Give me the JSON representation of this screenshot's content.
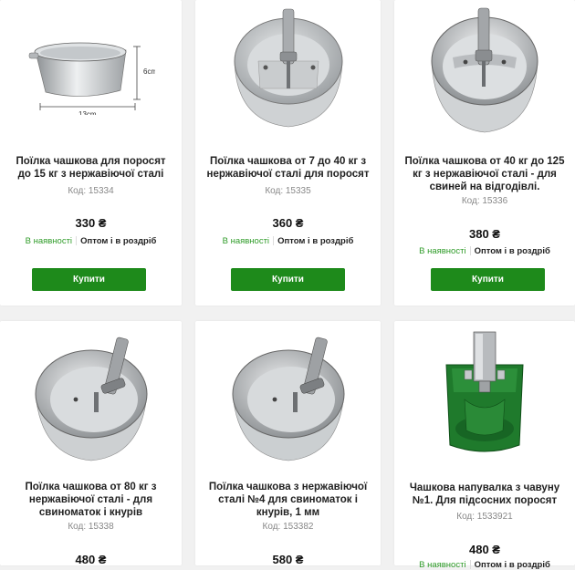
{
  "products": [
    {
      "title": "Поїлка чашкова для поросят до 15 кг з нержавіючої сталі",
      "code": "Код: 15334",
      "price": "330 ₴",
      "stock": "В наявності",
      "sale": "Оптом і в роздріб",
      "button": "Купити",
      "dimensions": {
        "height": "6cm",
        "width": "13cm"
      }
    },
    {
      "title": "Поїлка чашкова от 7 до 40 кг з нержавіючої сталі для поросят",
      "code": "Код: 15335",
      "price": "360 ₴",
      "stock": "В наявності",
      "sale": "Оптом і в роздріб",
      "button": "Купити"
    },
    {
      "title": "Поїлка чашкова от 40 кг до 125 кг з нержавіючої сталі - для свиней на відгодівлі.",
      "code": "Код: 15336",
      "price": "380 ₴",
      "stock": "В наявності",
      "sale": "Оптом і в роздріб",
      "button": "Купити"
    },
    {
      "title": "Поїлка чашкова от 80 кг з нержавіючої сталі - для свиноматок і кнурів",
      "code": "Код: 15338",
      "price": "480 ₴"
    },
    {
      "title": "Поїлка чашкова з нержавіючої сталі №4 для свиноматок і кнурів, 1 мм",
      "code": "Код: 153382",
      "price": "580 ₴"
    },
    {
      "title": "Чашкова напувалка з чавуну №1. Для підсосних поросят",
      "code": "Код: 1533921",
      "price": "480 ₴",
      "stock": "В наявності",
      "sale": "Оптом і в роздріб"
    }
  ],
  "colors": {
    "accent": "#1e8a1b",
    "in_stock": "#2e9b28",
    "page_background": "#f1f1f1"
  }
}
